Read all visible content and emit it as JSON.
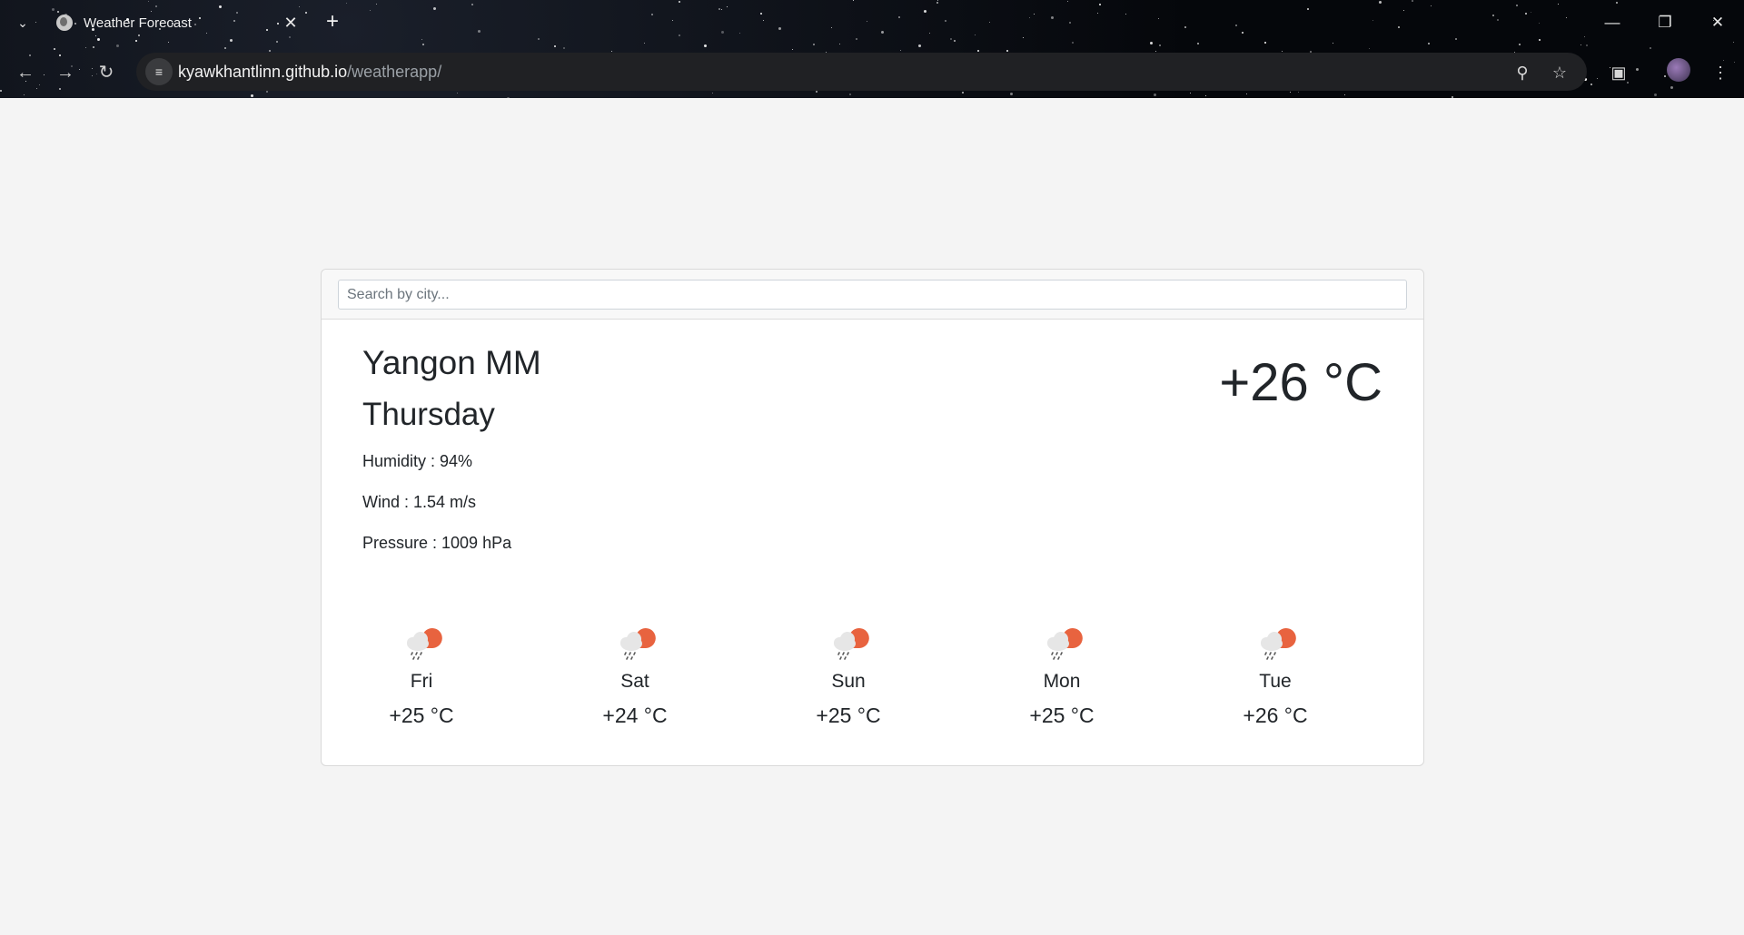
{
  "browser": {
    "tab_title": "Weather Forecast",
    "url_domain": "kyawkhantlinn.github.io",
    "url_path": "/weatherapp/"
  },
  "search": {
    "placeholder": "Search by city..."
  },
  "current": {
    "city": "Yangon MM",
    "day": "Thursday",
    "humidity": "Humidity : 94%",
    "wind": "Wind : 1.54 m/s",
    "pressure": "Pressure : 1009 hPa",
    "temperature": "+26 °C"
  },
  "forecast": [
    {
      "day": "Fri",
      "temp": "+25 °C",
      "icon": "rain-sun-icon"
    },
    {
      "day": "Sat",
      "temp": "+24 °C",
      "icon": "rain-sun-icon"
    },
    {
      "day": "Sun",
      "temp": "+25 °C",
      "icon": "rain-sun-icon"
    },
    {
      "day": "Mon",
      "temp": "+25 °C",
      "icon": "rain-sun-icon"
    },
    {
      "day": "Tue",
      "temp": "+26 °C",
      "icon": "rain-sun-icon"
    }
  ],
  "colors": {
    "sun": "#e8633f",
    "cloud": "#e6e6e6",
    "rain": "#5a5a5a",
    "page_bg": "#f4f4f4"
  }
}
